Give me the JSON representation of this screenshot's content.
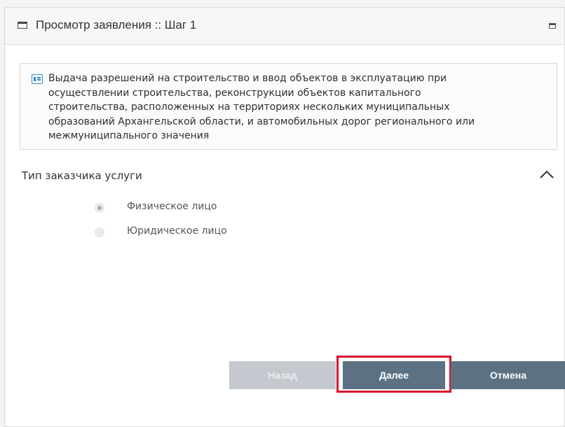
{
  "window": {
    "title": "Просмотр заявления :: Шаг 1"
  },
  "info": {
    "icon": "info-card-icon",
    "text": "Выдача разрешений на строительство и ввод объектов в эксплуатацию при\nосуществлении строительства, реконструкции объектов капитального\nстроительства, расположенных на территориях нескольких муниципальных\nобразований Архангельской области, и автомобильных дорог регионального или\nмежмуниципального значения"
  },
  "customer_section": {
    "title": "Тип заказчика услуги",
    "options": [
      {
        "label": "Физическое лицо",
        "checked": true
      },
      {
        "label": "Юридическое лицо",
        "checked": false
      }
    ]
  },
  "buttons": {
    "back": "Назад",
    "next": "Далее",
    "cancel": "Отмена"
  },
  "colors": {
    "button_primary": "#5c7283",
    "button_disabled": "#c3c9ce",
    "highlight": "#d8102e",
    "info_icon": "#2a8fc9"
  }
}
